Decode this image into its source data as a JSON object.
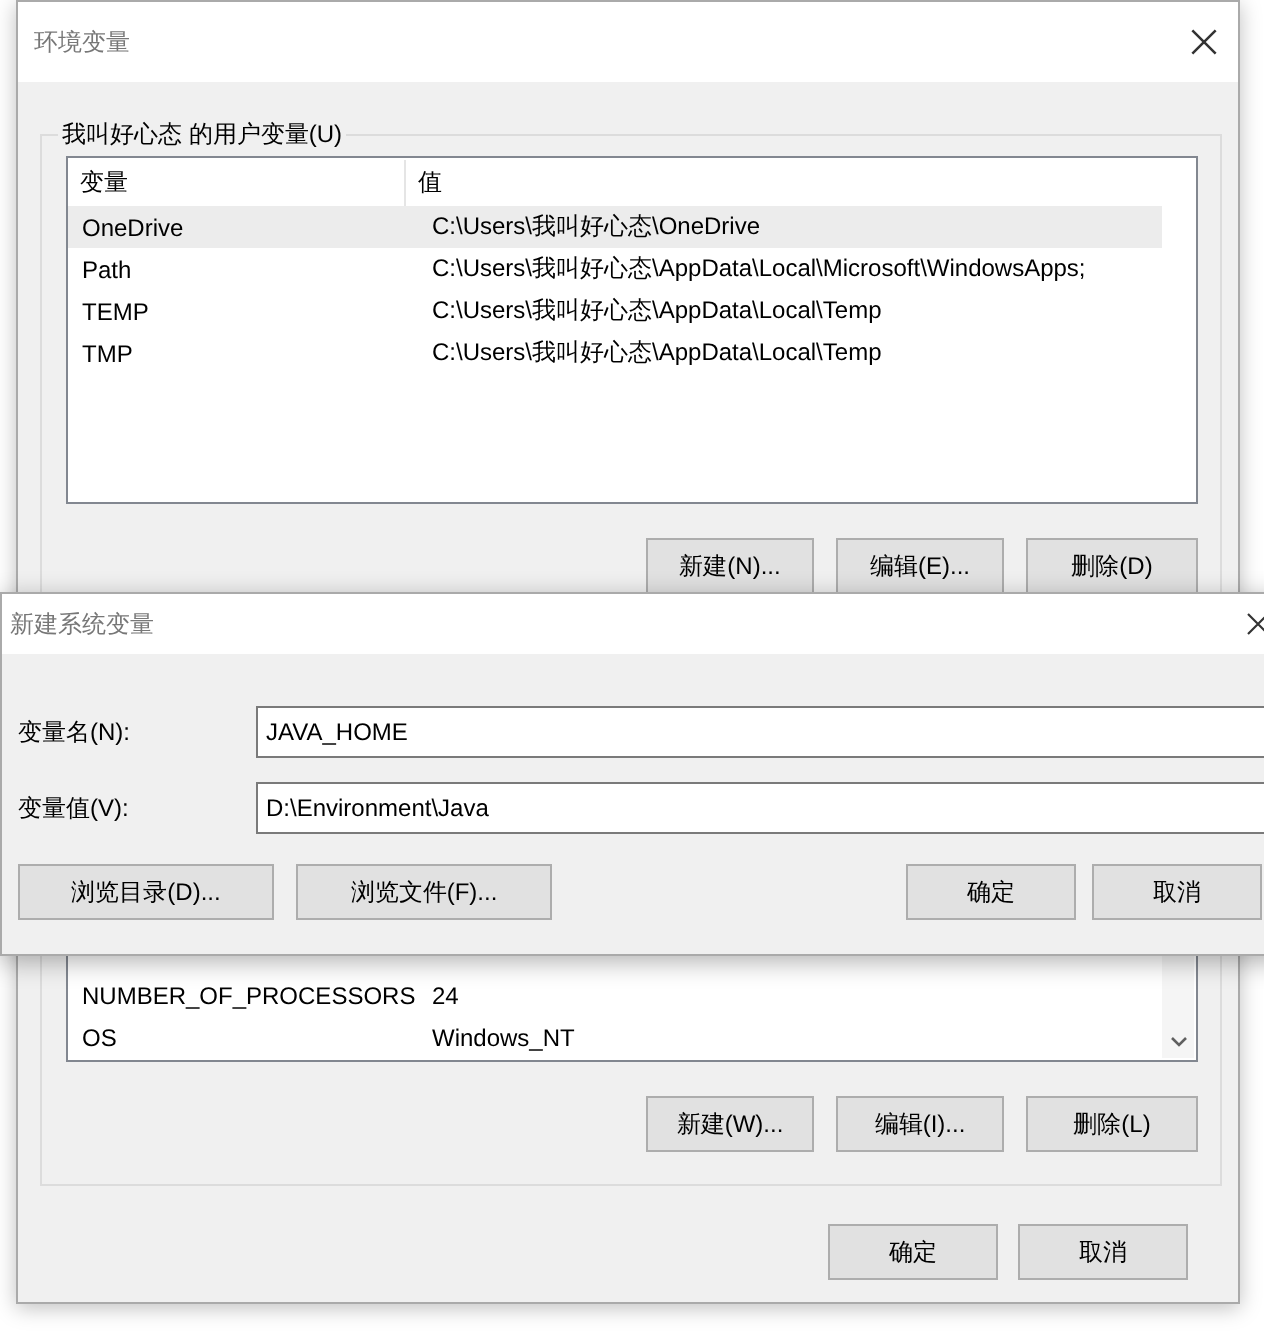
{
  "env_window": {
    "title": "环境变量"
  },
  "user_variables": {
    "label": "我叫好心态 的用户变量(U)",
    "columns": [
      "变量",
      "值"
    ],
    "rows": [
      {
        "name": "OneDrive",
        "value": "C:\\Users\\我叫好心态\\OneDrive",
        "selected": true
      },
      {
        "name": "Path",
        "value": "C:\\Users\\我叫好心态\\AppData\\Local\\Microsoft\\WindowsApps;",
        "selected": false
      },
      {
        "name": "TEMP",
        "value": "C:\\Users\\我叫好心态\\AppData\\Local\\Temp",
        "selected": false
      },
      {
        "name": "TMP",
        "value": "C:\\Users\\我叫好心态\\AppData\\Local\\Temp",
        "selected": false
      }
    ],
    "buttons": [
      "新建(N)...",
      "编辑(E)...",
      "删除(D)"
    ]
  },
  "system_variables": {
    "rows": [
      {
        "name": "NUMBER_OF_PROCESSORS",
        "value": "24",
        "selected": false
      },
      {
        "name": "OS",
        "value": "Windows_NT",
        "selected": false
      }
    ],
    "buttons": [
      "新建(W)...",
      "编辑(I)...",
      "删除(L)"
    ]
  },
  "buttons": [
    "确定",
    "取消"
  ],
  "new_variable_dialog": {
    "title": "新建系统变量",
    "fields": [
      {
        "label": "变量名(N):",
        "value": "JAVA_HOME"
      },
      {
        "label": "变量值(V):",
        "value": "D:\\Environment\\Java"
      }
    ],
    "left_buttons": [
      "浏览目录(D)...",
      "浏览文件(F)..."
    ],
    "right_buttons": [
      "确定",
      "取消"
    ]
  }
}
